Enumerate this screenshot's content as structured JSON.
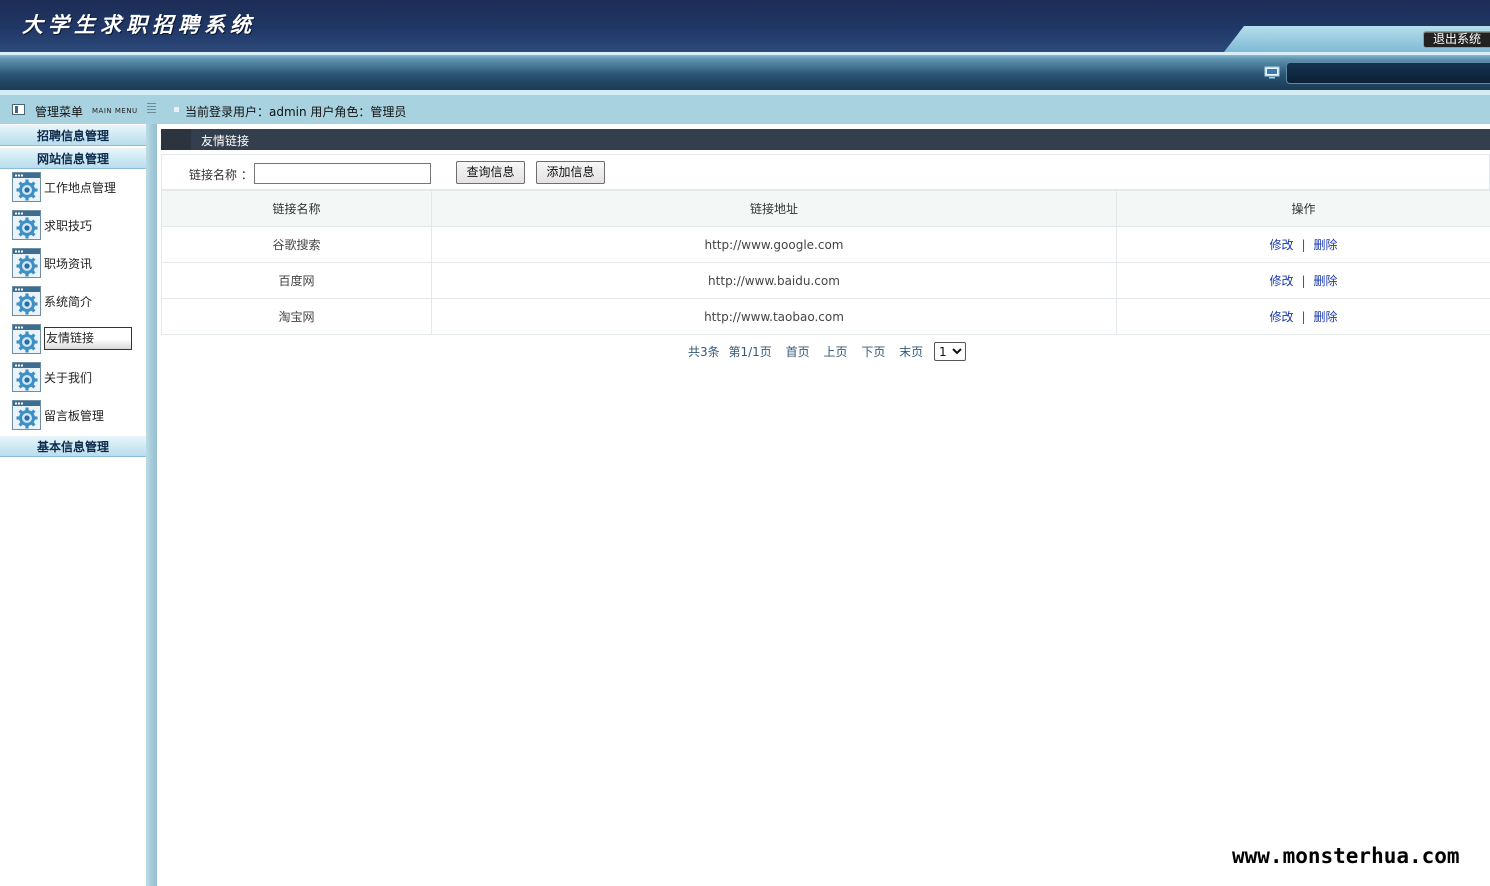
{
  "header": {
    "app_title": "大学生求职招聘系统",
    "logout_label": "退出系统"
  },
  "menu": {
    "title": "管理菜单",
    "subtitle": "MAIN MENU",
    "groups": [
      {
        "label": "招聘信息管理"
      },
      {
        "label": "网站信息管理"
      },
      {
        "label": "基本信息管理"
      }
    ],
    "items": [
      {
        "label": "工作地点管理"
      },
      {
        "label": "求职技巧"
      },
      {
        "label": "职场资讯"
      },
      {
        "label": "系统简介"
      },
      {
        "label": "友情链接",
        "active": true
      },
      {
        "label": "关于我们"
      },
      {
        "label": "留言板管理"
      }
    ]
  },
  "status": {
    "text": "当前登录用户：admin  用户角色：管理员"
  },
  "panel": {
    "title": "友情链接"
  },
  "search": {
    "label": "链接名称 ：",
    "value": "",
    "query_button": "查询信息",
    "add_button": "添加信息"
  },
  "table": {
    "headers": [
      "链接名称",
      "链接地址",
      "操作"
    ],
    "rows": [
      {
        "name": "谷歌搜索",
        "url": "http://www.google.com"
      },
      {
        "name": "百度网",
        "url": "http://www.baidu.com"
      },
      {
        "name": "淘宝网",
        "url": "http://www.taobao.com"
      }
    ],
    "edit_label": "修改",
    "delete_label": "删除",
    "separator": "|"
  },
  "pager": {
    "total": "共3条",
    "page_info": "第1/1页",
    "first": "首页",
    "prev": "上页",
    "next": "下页",
    "last": "末页",
    "selected_page": "1"
  },
  "watermark": "www.monsterhua.com",
  "colors": {
    "header_dark": "#1c2c55",
    "frame_blue": "#a8d2df",
    "panel_title_bg": "#343f4d",
    "link_blue": "#1a39a8"
  }
}
